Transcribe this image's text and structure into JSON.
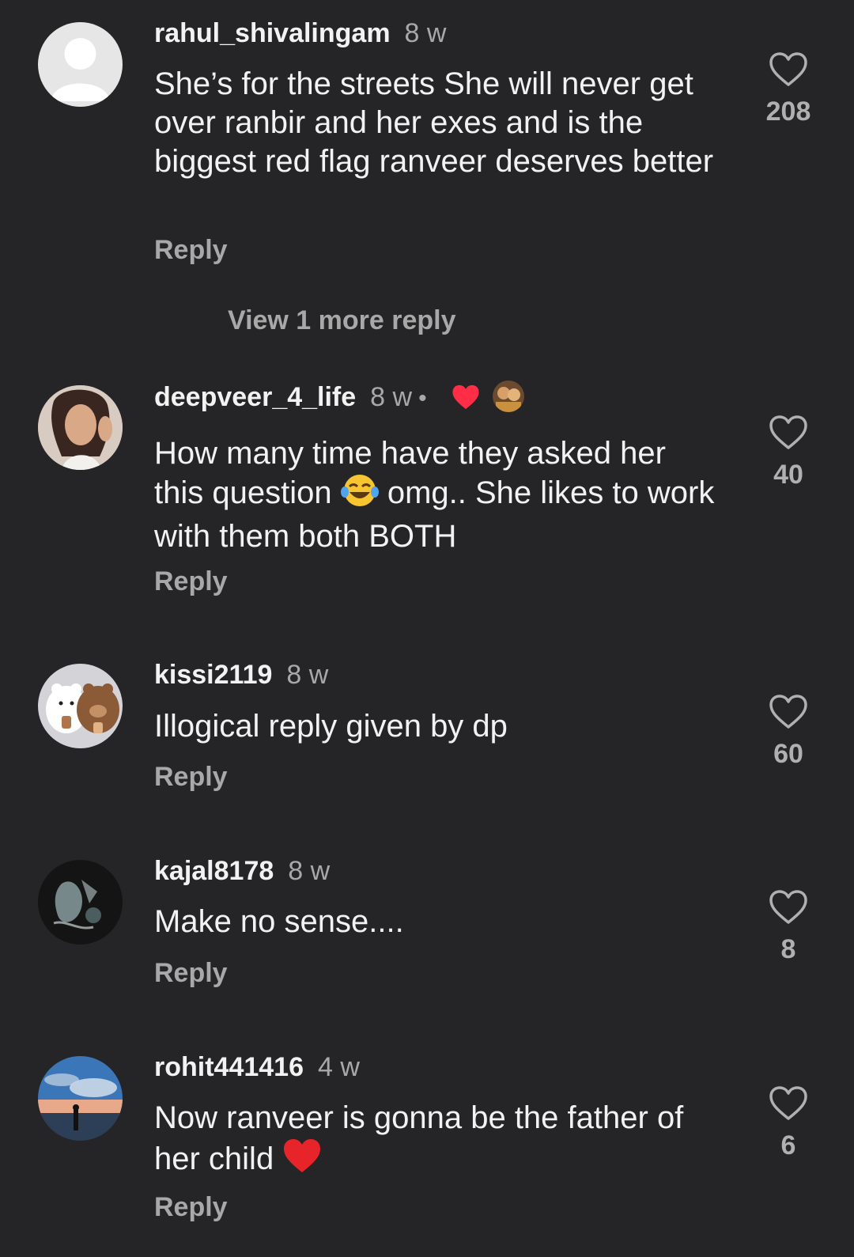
{
  "comments": [
    {
      "username": "rahul_shivalingam",
      "time": "8 w",
      "text": "She’s for the streets She will never get over ranbir and her exes and is the biggest red flag ranveer deserves better",
      "reply_label": "Reply",
      "likes": "208",
      "view_more": "View 1 more reply"
    },
    {
      "username": "deepveer_4_life",
      "time": "8 w",
      "text_part1": "How many time have they asked her this question ",
      "emoji": "😂",
      "text_part2": " omg.. She likes to work with them both BOTH",
      "reply_label": "Reply",
      "likes": "40"
    },
    {
      "username": "kissi2119",
      "time": "8 w",
      "text": "Illogical reply given by dp",
      "reply_label": "Reply",
      "likes": "60"
    },
    {
      "username": "kajal8178",
      "time": "8 w",
      "text": "Make no sense....",
      "reply_label": "Reply",
      "likes": "8"
    },
    {
      "username": "rohit441416",
      "time": "4 w",
      "text": "Now ranveer is gonna be the father of her child ",
      "emoji": "❤️",
      "reply_label": "Reply",
      "likes": "6"
    }
  ],
  "colors": {
    "background": "#252527",
    "text": "#f2f2f2",
    "muted": "#a8a8a8",
    "like_red": "#ff2d45"
  },
  "icons": {
    "like": "heart-outline-icon",
    "creator_liked": "red-heart-icon"
  }
}
